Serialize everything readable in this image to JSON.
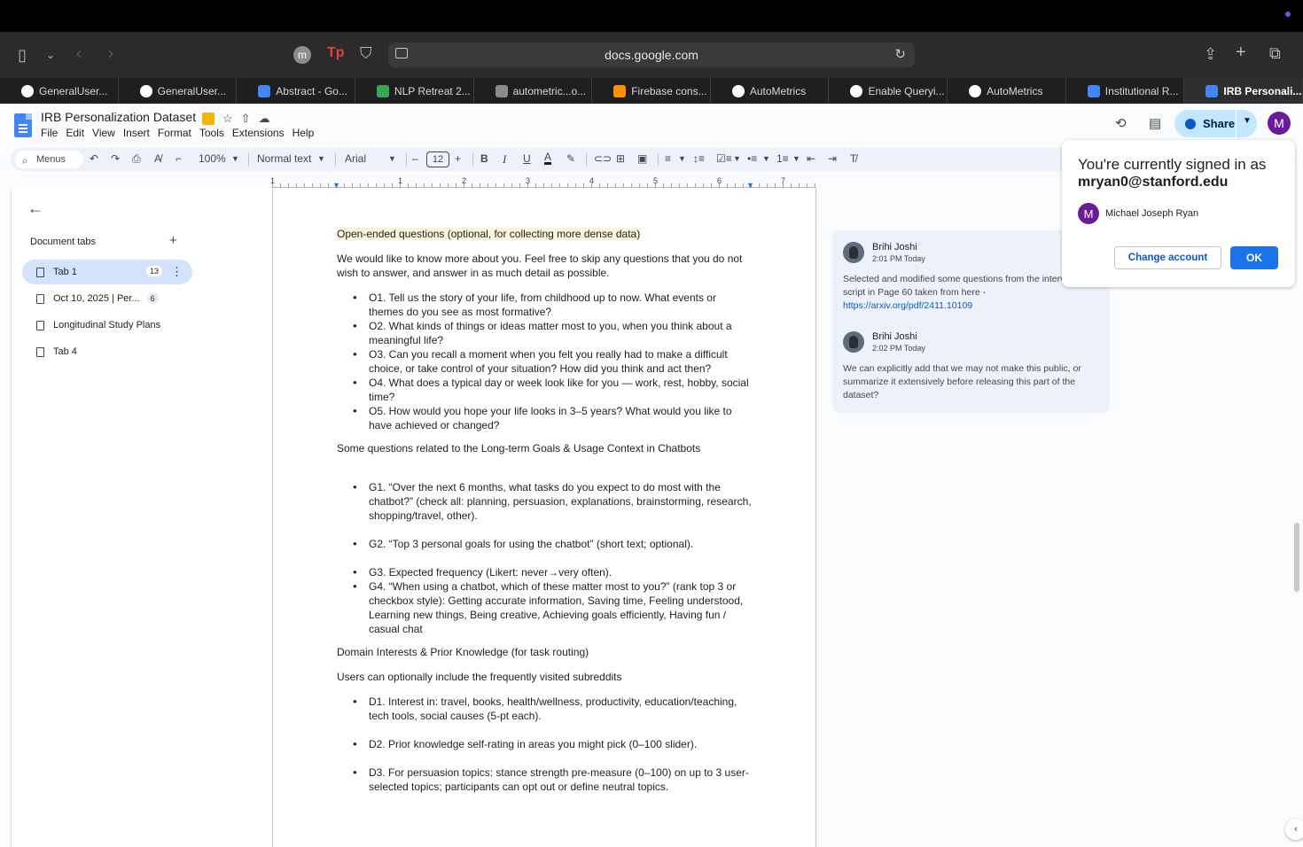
{
  "browser": {
    "url": "docs.google.com",
    "profile_initial": "m",
    "tabs": [
      {
        "label": "GeneralUser...",
        "icon": "github-icon"
      },
      {
        "label": "GeneralUser...",
        "icon": "github-icon"
      },
      {
        "label": "Abstract - Go...",
        "icon": "google-docs-icon"
      },
      {
        "label": "NLP Retreat 2...",
        "icon": "google-sheets-icon"
      },
      {
        "label": "autometric...o...",
        "icon": "gear-icon"
      },
      {
        "label": "Firebase cons...",
        "icon": "firebase-icon"
      },
      {
        "label": "AutoMetrics",
        "icon": "autometrics-icon"
      },
      {
        "label": "Enable Queryi...",
        "icon": "github-icon"
      },
      {
        "label": "AutoMetrics",
        "icon": "autometrics-icon"
      },
      {
        "label": "Institutional R...",
        "icon": "google-docs-icon"
      },
      {
        "label": "IRB Personali...",
        "icon": "google-docs-icon"
      }
    ]
  },
  "docs": {
    "title": "IRB Personalization Dataset",
    "menus": [
      "File",
      "Edit",
      "View",
      "Insert",
      "Format",
      "Tools",
      "Extensions",
      "Help"
    ],
    "share_label": "Share",
    "user_initial": "M",
    "toolbar": {
      "search_label": "Menus",
      "zoom": "100%",
      "style": "Normal text",
      "font": "Arial",
      "font_size": "12"
    }
  },
  "sidebar": {
    "title": "Document tabs",
    "tabs": [
      {
        "label": "Tab 1",
        "count": "13"
      },
      {
        "label": "Oct 10, 2025 | Per...",
        "count": "6"
      },
      {
        "label": "Longitudinal Study Plans",
        "count": ""
      },
      {
        "label": "Tab 4",
        "count": ""
      }
    ]
  },
  "ruler": [
    "1",
    "1",
    "2",
    "3",
    "4",
    "5",
    "6",
    "7"
  ],
  "document": {
    "heading_open": "Open-ended questions (optional, for collecting more dense data)",
    "intro": "We would like to know more about you. Feel free to skip any questions that you do not wish to answer, and answer in as much detail as possible.",
    "open_items": [
      "O1. Tell us the story of your life, from childhood up to now. What events or themes do you see as most formative?",
      "O2. What kinds of things or ideas matter most to you, when you think about a meaningful life?",
      "O3. Can you recall a moment when you felt you really had to make a difficult choice, or take control of your situation? How did you think and act then?",
      "O4. What does a typical day or week look like for you — work, rest, hobby, social time?",
      "O5. How would you hope your life looks in 3–5 years? What would you like to have achieved or changed?"
    ],
    "goals_heading": "Some questions related to the Long-term Goals & Usage Context in Chatbots",
    "goal_items": [
      "G1. “Over the next 6 months, what tasks do you expect to do most with the chatbot?” (check all: planning, persuasion, explanations, brainstorming, research, shopping/travel, other).",
      "G2. “Top 3 personal goals for using the chatbot” (short text; optional).",
      "G3. Expected frequency (Likert: never→very often).",
      "G4. “When using a chatbot, which of these matter most to you?” (rank top 3 or checkbox style): Getting accurate information, Saving time, Feeling understood, Learning new things, Being creative, Achieving goals efficiently, Having fun / casual chat"
    ],
    "domain_heading": "Domain Interests & Prior Knowledge (for task routing)",
    "subreddit_note": "Users can optionally include the frequently visited subreddits",
    "domain_items": [
      "D1. Interest in: travel, books, health/wellness, productivity, education/teaching, tech tools, social causes (5-pt each).",
      "D2. Prior knowledge self-rating in areas you might pick (0–100 slider).",
      "D3. For persuasion topics: stance strength pre-measure (0–100) on up to 3 user-selected topics; participants can opt out or define neutral topics."
    ]
  },
  "comments": [
    {
      "author": "Brihi Joshi",
      "time": "2:01 PM Today",
      "body": "Selected and modified some questions from the interview script in Page 60 taken from here - ",
      "link": "https://arxiv.org/pdf/2411.10109"
    },
    {
      "author": "Brihi Joshi",
      "time": "2:02 PM Today",
      "body": "We can explicitly add that we may not make this public, or summarize it extensively before releasing this part of the dataset?",
      "link": ""
    }
  ],
  "signin_popup": {
    "line1": "You're currently signed in as",
    "email": "mryan0@stanford.edu",
    "avatar_initial": "M",
    "name": "Michael Joseph Ryan",
    "change_label": "Change account",
    "ok_label": "OK"
  }
}
